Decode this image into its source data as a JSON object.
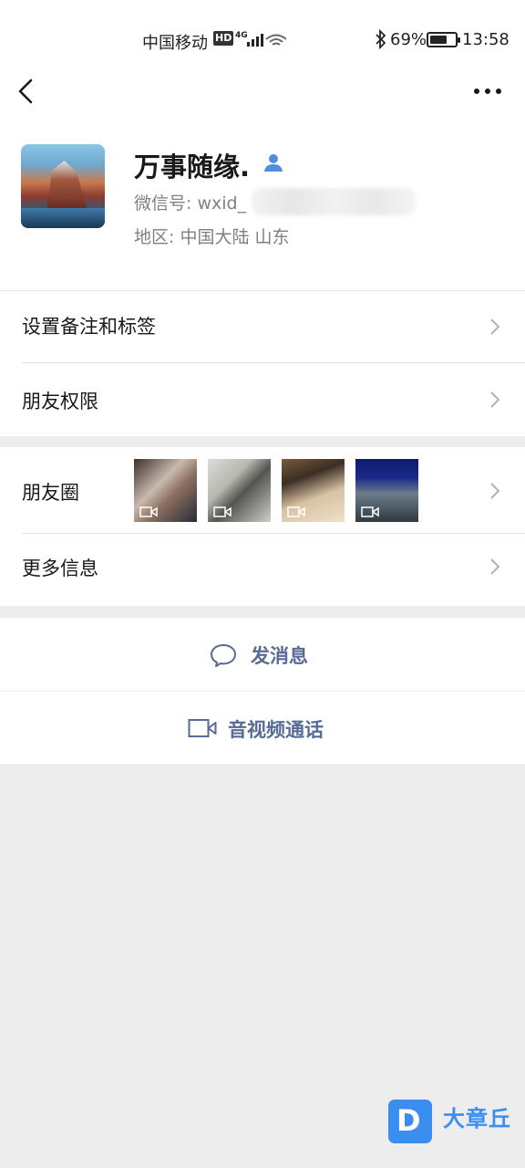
{
  "status_bar": {
    "carrier": "中国移动",
    "hd": "HD",
    "network": "4G",
    "battery_pct": "69%",
    "battery_level": 0.69,
    "time": "13:58"
  },
  "nav": {
    "back_icon": "chevron-left-icon",
    "more_icon": "more-dots-icon"
  },
  "profile": {
    "name": "万事随缘.",
    "wechat_id_label": "微信号: wxid_",
    "region": "地区: 中国大陆  山东"
  },
  "rows": {
    "remark": "设置备注和标签",
    "permissions": "朋友权限",
    "moments": "朋友圈",
    "more_info": "更多信息"
  },
  "actions": {
    "message": "发消息",
    "call": "音视频通话"
  },
  "watermark": {
    "text": "大章丘",
    "letter": "D"
  },
  "colors": {
    "link_blue": "#576b95",
    "background": "#ededed"
  }
}
